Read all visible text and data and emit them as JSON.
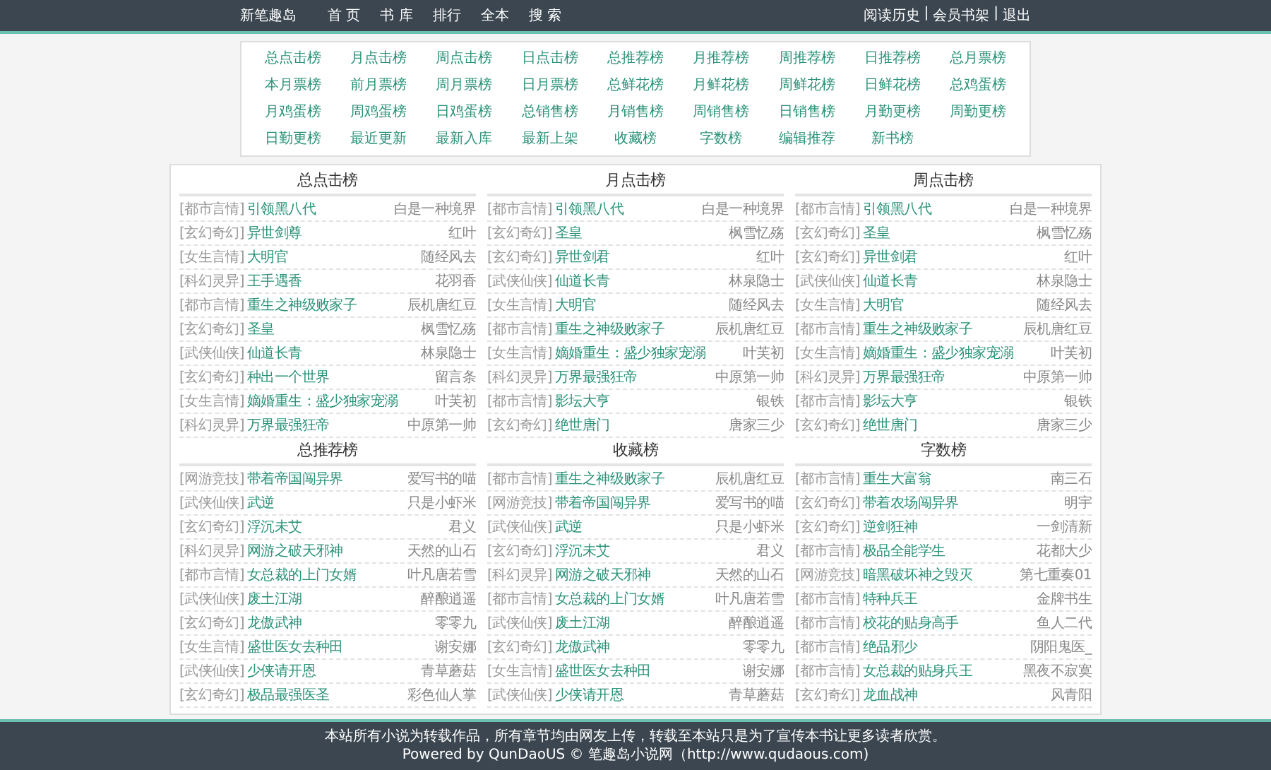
{
  "nav": {
    "logo": "新笔趣岛",
    "items": [
      "首 页",
      "书 库",
      "排行",
      "全本",
      "搜 索"
    ],
    "user_links": [
      "阅读历史",
      "会员书架",
      "退出"
    ],
    "separator": "|"
  },
  "rank_links": [
    "总点击榜",
    "月点击榜",
    "周点击榜",
    "日点击榜",
    "总推荐榜",
    "月推荐榜",
    "周推荐榜",
    "日推荐榜",
    "总月票榜",
    "本月票榜",
    "前月票榜",
    "周月票榜",
    "日月票榜",
    "总鲜花榜",
    "月鲜花榜",
    "周鲜花榜",
    "日鲜花榜",
    "总鸡蛋榜",
    "月鸡蛋榜",
    "周鸡蛋榜",
    "日鸡蛋榜",
    "总销售榜",
    "月销售榜",
    "周销售榜",
    "日销售榜",
    "月勤更榜",
    "周勤更榜",
    "日勤更榜",
    "最近更新",
    "最新入库",
    "最新上架",
    "收藏榜",
    "字数榜",
    "编辑推荐",
    "新书榜"
  ],
  "sections": [
    {
      "title": "总点击榜",
      "rows": [
        {
          "category": "[都市言情]",
          "book": "引领黑八代",
          "author": "白是一种境界"
        },
        {
          "category": "[玄幻奇幻]",
          "book": "异世剑尊",
          "author": "红叶"
        },
        {
          "category": "[女生言情]",
          "book": "大明官",
          "author": "随经风去"
        },
        {
          "category": "[科幻灵异]",
          "book": "王手遇香",
          "author": "花羽香"
        },
        {
          "category": "[都市言情]",
          "book": "重生之神级败家子",
          "author": "辰机唐红豆"
        },
        {
          "category": "[玄幻奇幻]",
          "book": "圣皇",
          "author": "枫雪忆殇"
        },
        {
          "category": "[武侠仙侠]",
          "book": "仙道长青",
          "author": "林泉隐士"
        },
        {
          "category": "[玄幻奇幻]",
          "book": "种出一个世界",
          "author": "留言条"
        },
        {
          "category": "[女生言情]",
          "book": "嫡婚重生：盛少独家宠溺",
          "author": "叶芙初"
        },
        {
          "category": "[科幻灵异]",
          "book": "万界最强狂帝",
          "author": "中原第一帅"
        }
      ]
    },
    {
      "title": "月点击榜",
      "rows": [
        {
          "category": "[都市言情]",
          "book": "引领黑八代",
          "author": "白是一种境界"
        },
        {
          "category": "[玄幻奇幻]",
          "book": "圣皇",
          "author": "枫雪忆殇"
        },
        {
          "category": "[玄幻奇幻]",
          "book": "异世剑君",
          "author": "红叶"
        },
        {
          "category": "[武侠仙侠]",
          "book": "仙道长青",
          "author": "林泉隐士"
        },
        {
          "category": "[女生言情]",
          "book": "大明官",
          "author": "随经风去"
        },
        {
          "category": "[都市言情]",
          "book": "重生之神级败家子",
          "author": "辰机唐红豆"
        },
        {
          "category": "[女生言情]",
          "book": "嫡婚重生：盛少独家宠溺",
          "author": "叶芙初"
        },
        {
          "category": "[科幻灵异]",
          "book": "万界最强狂帝",
          "author": "中原第一帅"
        },
        {
          "category": "[都市言情]",
          "book": "影坛大亨",
          "author": "银铁"
        },
        {
          "category": "[玄幻奇幻]",
          "book": "绝世唐门",
          "author": "唐家三少"
        }
      ]
    },
    {
      "title": "周点击榜",
      "rows": [
        {
          "category": "[都市言情]",
          "book": "引领黑八代",
          "author": "白是一种境界"
        },
        {
          "category": "[玄幻奇幻]",
          "book": "圣皇",
          "author": "枫雪忆殇"
        },
        {
          "category": "[玄幻奇幻]",
          "book": "异世剑君",
          "author": "红叶"
        },
        {
          "category": "[武侠仙侠]",
          "book": "仙道长青",
          "author": "林泉隐士"
        },
        {
          "category": "[女生言情]",
          "book": "大明官",
          "author": "随经风去"
        },
        {
          "category": "[都市言情]",
          "book": "重生之神级败家子",
          "author": "辰机唐红豆"
        },
        {
          "category": "[女生言情]",
          "book": "嫡婚重生：盛少独家宠溺",
          "author": "叶芙初"
        },
        {
          "category": "[科幻灵异]",
          "book": "万界最强狂帝",
          "author": "中原第一帅"
        },
        {
          "category": "[都市言情]",
          "book": "影坛大亨",
          "author": "银铁"
        },
        {
          "category": "[玄幻奇幻]",
          "book": "绝世唐门",
          "author": "唐家三少"
        }
      ]
    },
    {
      "title": "总推荐榜",
      "rows": [
        {
          "category": "[网游竞技]",
          "book": "带着帝国闯异界",
          "author": "爱写书的喵"
        },
        {
          "category": "[武侠仙侠]",
          "book": "武逆",
          "author": "只是小虾米"
        },
        {
          "category": "[玄幻奇幻]",
          "book": "浮沉未艾",
          "author": "君义"
        },
        {
          "category": "[科幻灵异]",
          "book": "网游之破天邪神",
          "author": "天然的山石"
        },
        {
          "category": "[都市言情]",
          "book": "女总裁的上门女婿",
          "author": "叶凡唐若雪"
        },
        {
          "category": "[武侠仙侠]",
          "book": "废土江湖",
          "author": "醉酿逍遥"
        },
        {
          "category": "[玄幻奇幻]",
          "book": "龙傲武神",
          "author": "零零九"
        },
        {
          "category": "[女生言情]",
          "book": "盛世医女去种田",
          "author": "谢安娜"
        },
        {
          "category": "[武侠仙侠]",
          "book": "少侠请开恩",
          "author": "青草蘑菇"
        },
        {
          "category": "[玄幻奇幻]",
          "book": "极品最强医圣",
          "author": "彩色仙人掌"
        }
      ]
    },
    {
      "title": "收藏榜",
      "rows": [
        {
          "category": "[都市言情]",
          "book": "重生之神级败家子",
          "author": "辰机唐红豆"
        },
        {
          "category": "[网游竞技]",
          "book": "带着帝国闯异界",
          "author": "爱写书的喵"
        },
        {
          "category": "[武侠仙侠]",
          "book": "武逆",
          "author": "只是小虾米"
        },
        {
          "category": "[玄幻奇幻]",
          "book": "浮沉未艾",
          "author": "君义"
        },
        {
          "category": "[科幻灵异]",
          "book": "网游之破天邪神",
          "author": "天然的山石"
        },
        {
          "category": "[都市言情]",
          "book": "女总裁的上门女婿",
          "author": "叶凡唐若雪"
        },
        {
          "category": "[武侠仙侠]",
          "book": "废土江湖",
          "author": "醉酿逍遥"
        },
        {
          "category": "[玄幻奇幻]",
          "book": "龙傲武神",
          "author": "零零九"
        },
        {
          "category": "[女生言情]",
          "book": "盛世医女去种田",
          "author": "谢安娜"
        },
        {
          "category": "[武侠仙侠]",
          "book": "少侠请开恩",
          "author": "青草蘑菇"
        }
      ]
    },
    {
      "title": "字数榜",
      "rows": [
        {
          "category": "[都市言情]",
          "book": "重生大富翁",
          "author": "南三石"
        },
        {
          "category": "[玄幻奇幻]",
          "book": "带着农场闯异界",
          "author": "明宇"
        },
        {
          "category": "[玄幻奇幻]",
          "book": "逆剑狂神",
          "author": "一剑清新"
        },
        {
          "category": "[都市言情]",
          "book": "极品全能学生",
          "author": "花都大少"
        },
        {
          "category": "[网游竞技]",
          "book": "暗黑破坏神之毁灭",
          "author": "第七重奏01"
        },
        {
          "category": "[都市言情]",
          "book": "特种兵王",
          "author": "金牌书生"
        },
        {
          "category": "[都市言情]",
          "book": "校花的贴身高手",
          "author": "鱼人二代"
        },
        {
          "category": "[都市言情]",
          "book": "绝品邪少",
          "author": "阴阳鬼医_"
        },
        {
          "category": "[都市言情]",
          "book": "女总裁的贴身兵王",
          "author": "黑夜不寂寞"
        },
        {
          "category": "[玄幻奇幻]",
          "book": "龙血战神",
          "author": "风青阳"
        }
      ]
    }
  ],
  "footer": {
    "notice": "本站所有小说为转载作品，所有章节均由网友上传，转载至本站只是为了宣传本书让更多读者欣赏。",
    "powered": "Powered by QunDaoUS © 笔趣岛小说网（http://www.qudaous.com)"
  }
}
